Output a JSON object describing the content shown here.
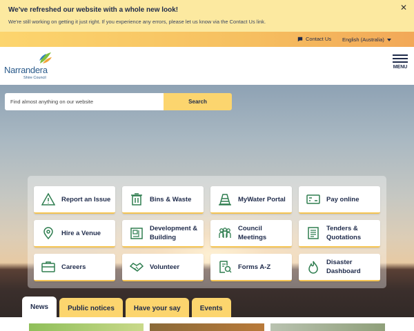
{
  "announcement": {
    "title": "We've refreshed our website with a whole new look!",
    "message": "We're still working on getting it just right. If you experience any errors, please let us know via the Contact Us link.",
    "close": "✕"
  },
  "utility": {
    "contact": "Contact Us",
    "language": "English (Australia)"
  },
  "header": {
    "logo_name": "Narrandera",
    "logo_sub": "Shire Council",
    "menu_label": "MENU"
  },
  "search": {
    "placeholder": "Find almost anything on our website",
    "button": "Search"
  },
  "tiles": [
    {
      "label": "Report an Issue",
      "icon": "warning-icon"
    },
    {
      "label": "Bins & Waste",
      "icon": "bin-icon"
    },
    {
      "label": "MyWater Portal",
      "icon": "cone-icon"
    },
    {
      "label": "Pay online",
      "icon": "payment-card-icon"
    },
    {
      "label": "Hire a Venue",
      "icon": "location-pin-icon"
    },
    {
      "label": "Development & Building",
      "icon": "blueprint-icon"
    },
    {
      "label": "Council Meetings",
      "icon": "people-icon"
    },
    {
      "label": "Tenders & Quotations",
      "icon": "document-icon"
    },
    {
      "label": "Careers",
      "icon": "briefcase-icon"
    },
    {
      "label": "Volunteer",
      "icon": "handshake-icon"
    },
    {
      "label": "Forms A-Z",
      "icon": "form-search-icon"
    },
    {
      "label": "Disaster Dashboard",
      "icon": "flame-icon"
    }
  ],
  "tabs": [
    {
      "label": "News",
      "active": true
    },
    {
      "label": "Public notices",
      "active": false
    },
    {
      "label": "Have your say",
      "active": false
    },
    {
      "label": "Events",
      "active": false
    }
  ],
  "colors": {
    "navy": "#1e2a4a",
    "accent_yellow": "#fcd56e",
    "icon_green": "#2e7d4f",
    "logo_blue": "#2a5a8a"
  }
}
